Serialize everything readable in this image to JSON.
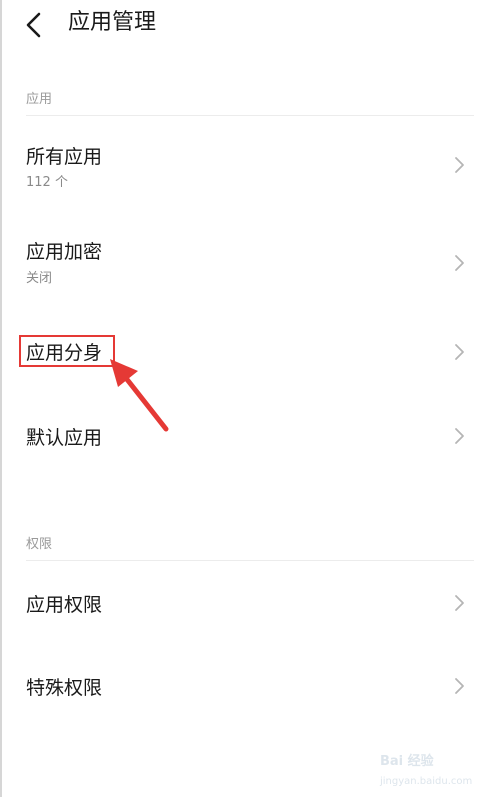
{
  "header": {
    "title": "应用管理"
  },
  "sections": [
    {
      "label": "应用"
    },
    {
      "label": "权限"
    }
  ],
  "items": [
    {
      "title": "所有应用",
      "subtitle": "112 个"
    },
    {
      "title": "应用加密",
      "subtitle": "关闭"
    },
    {
      "title": "应用分身"
    },
    {
      "title": "默认应用"
    },
    {
      "title": "应用权限"
    },
    {
      "title": "特殊权限"
    }
  ],
  "annotation": {
    "color": "#e53935"
  },
  "watermark": {
    "brand": "Bai 经验",
    "url": "jingyan.baidu.com"
  }
}
